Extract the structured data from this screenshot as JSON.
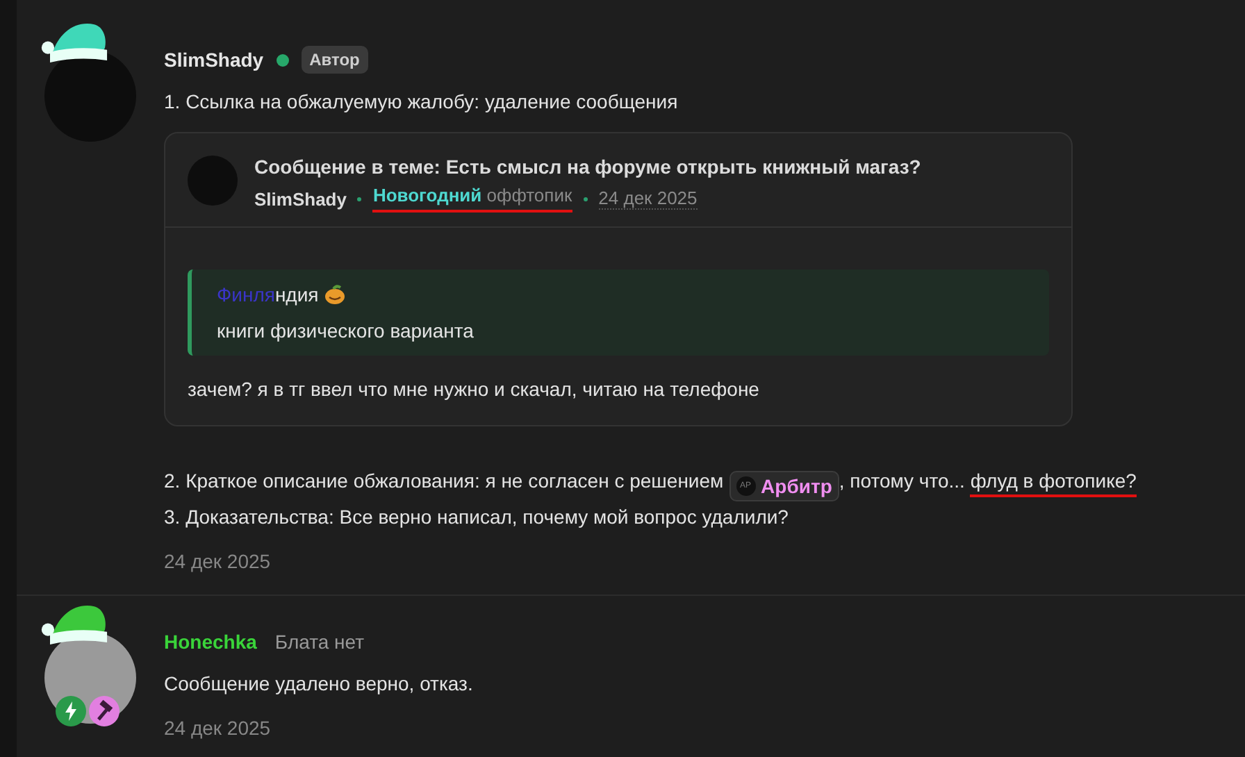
{
  "posts": [
    {
      "author": "SlimShady",
      "online": true,
      "badge": "Автор",
      "hat": {
        "color": "#3fd8b8"
      },
      "lines": [
        [
          {
            "kind": "text",
            "text": "1. Ссылка на обжалуемую жалобу: удаление сообщения",
            "underlined": false
          }
        ]
      ],
      "quote_card": {
        "title": "Сообщение в теме: Есть смысл на форуме открыть книжный магаз?",
        "author": "SlimShady",
        "prefix": "Новогодний",
        "forum": "оффтопик",
        "underlined": true,
        "date": "24 дек 2025",
        "quote": {
          "author_parts": [
            {
              "text": "Финля",
              "color": "#3a35c8"
            },
            {
              "text": "ндия",
              "color": "#e6e6e6"
            }
          ],
          "text": "книги физического варианта"
        },
        "reply": "зачем? я в тг ввел что мне нужно и скачал, читаю на телефоне"
      },
      "after": [
        [
          {
            "kind": "text",
            "text": "2. Краткое описание обжалования: я не согласен с решением ",
            "underlined": false
          },
          {
            "kind": "mention",
            "text": "Арбитр",
            "avatar": "AP"
          },
          {
            "kind": "text",
            "text": ", потому что... ",
            "underlined": false
          },
          {
            "kind": "text",
            "text": "флуд в фотопике?",
            "underlined": true
          }
        ],
        [
          {
            "kind": "text",
            "text": "3. Доказательства: Все верно написал, почему мой вопрос удалили?",
            "underlined": false
          }
        ]
      ],
      "date": "24 дек 2025"
    },
    {
      "author": "Honechka",
      "status": "Блата нет",
      "hat": {
        "color": "#3cc83c"
      },
      "icons": [
        {
          "kind": "bolt",
          "color": "#2a9a4a"
        },
        {
          "kind": "hammer",
          "color": "#e27fe0"
        }
      ],
      "lines": [
        [
          {
            "kind": "text",
            "text": "Сообщение удалено верно, отказ.",
            "underlined": false
          }
        ]
      ],
      "date": "24 дек 2025"
    }
  ]
}
